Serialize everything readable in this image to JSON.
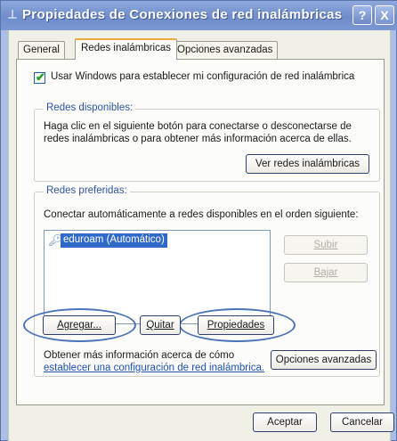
{
  "window": {
    "title": "Propiedades de Conexiones de red inalámbricas",
    "help_label": "?",
    "close_label": "X"
  },
  "tabs": [
    {
      "label": "General"
    },
    {
      "label": "Redes inalámbricas"
    },
    {
      "label": "Opciones avanzadas"
    }
  ],
  "checkbox": {
    "label": "Usar Windows para establecer mi configuración de red inalámbrica",
    "checked": true
  },
  "available_networks": {
    "legend": "Redes disponibles:",
    "description_line1": "Haga clic en el siguiente botón para conectarse o desconectarse de",
    "description_line2": "redes inalámbricas o para obtener más información acerca de ellas.",
    "view_button": "Ver redes inalámbricas"
  },
  "preferred_networks": {
    "legend": "Redes preferidas:",
    "description": "Conectar automáticamente a redes disponibles en el orden siguiente:",
    "items": [
      {
        "label": "eduroam (Automático)",
        "icon": "wireless-network-icon"
      }
    ],
    "up_button": "Subir",
    "down_button": "Bajar",
    "add_button": "Agregar...",
    "remove_button": "Quitar",
    "properties_button": "Propiedades",
    "info_text": "Obtener más información acerca de cómo",
    "info_link": "establecer una configuración de red inalámbrica.",
    "advanced_button": "Opciones avanzadas"
  },
  "footer": {
    "accept_button": "Aceptar",
    "cancel_button": "Cancelar"
  },
  "colors": {
    "title_bar": "#7b97d2",
    "highlight_ellipse": "#4b73b9",
    "selection": "#3169c6"
  }
}
